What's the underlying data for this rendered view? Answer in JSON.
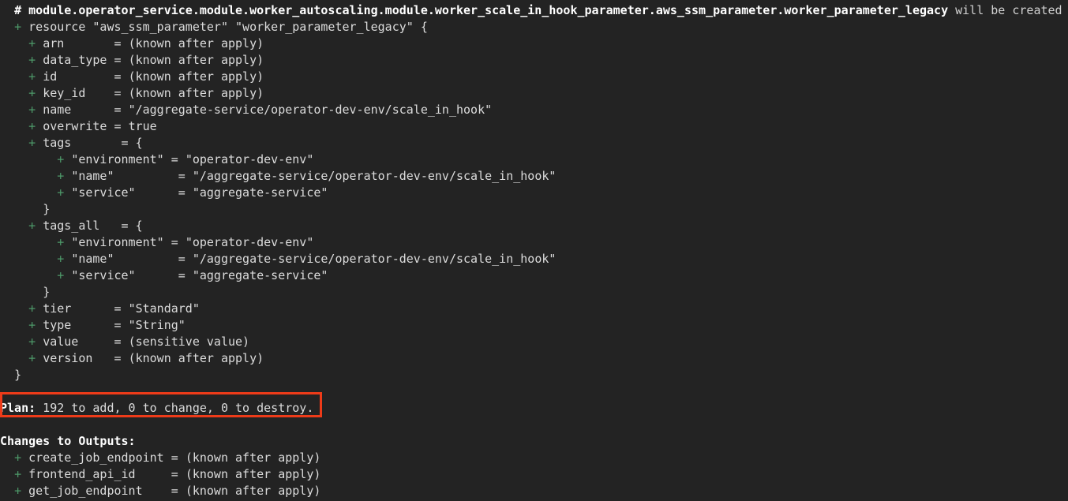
{
  "terminal": {
    "background_color": "#232323",
    "foreground_color": "#dcdcdc",
    "accent_add_color": "#4e9a6a",
    "annotation_color": "#ee3b19",
    "header": {
      "comment_marker": "#",
      "resource_address": "module.operator_service.module.worker_autoscaling.module.worker_scale_in_hook_parameter.aws_ssm_parameter.worker_parameter_legacy",
      "action_text": "will be created"
    },
    "resource": {
      "marker": "+",
      "keyword": "resource",
      "type": "\"aws_ssm_parameter\"",
      "name": "\"worker_parameter_legacy\"",
      "open_brace": "{",
      "close_brace": "}"
    },
    "attributes": [
      {
        "marker": "+",
        "name": "arn",
        "pad": "      ",
        "eq": "=",
        "value": "(known after apply)"
      },
      {
        "marker": "+",
        "name": "data_type",
        "pad": "",
        "eq": "=",
        "value": "(known after apply)"
      },
      {
        "marker": "+",
        "name": "id",
        "pad": "       ",
        "eq": "=",
        "value": "(known after apply)"
      },
      {
        "marker": "+",
        "name": "key_id",
        "pad": "   ",
        "eq": "=",
        "value": "(known after apply)"
      },
      {
        "marker": "+",
        "name": "name",
        "pad": "     ",
        "eq": "=",
        "value": "\"/aggregate-service/operator-dev-env/scale_in_hook\""
      },
      {
        "marker": "+",
        "name": "overwrite",
        "pad": "",
        "eq": "=",
        "value": "true"
      }
    ],
    "tags_block": {
      "marker": "+",
      "label": "tags",
      "label_pad": "      ",
      "eq": "=",
      "open_brace": "{",
      "close_brace": "}",
      "entries": [
        {
          "marker": "+",
          "key": "\"environment\"",
          "pad": "",
          "eq": "=",
          "value": "\"operator-dev-env\""
        },
        {
          "marker": "+",
          "key": "\"name\"",
          "pad": "        ",
          "eq": "=",
          "value": "\"/aggregate-service/operator-dev-env/scale_in_hook\""
        },
        {
          "marker": "+",
          "key": "\"service\"",
          "pad": "     ",
          "eq": "=",
          "value": "\"aggregate-service\""
        }
      ]
    },
    "tags_all_block": {
      "marker": "+",
      "label": "tags_all",
      "label_pad": "  ",
      "eq": "=",
      "open_brace": "{",
      "close_brace": "}",
      "entries": [
        {
          "marker": "+",
          "key": "\"environment\"",
          "pad": "",
          "eq": "=",
          "value": "\"operator-dev-env\""
        },
        {
          "marker": "+",
          "key": "\"name\"",
          "pad": "        ",
          "eq": "=",
          "value": "\"/aggregate-service/operator-dev-env/scale_in_hook\""
        },
        {
          "marker": "+",
          "key": "\"service\"",
          "pad": "     ",
          "eq": "=",
          "value": "\"aggregate-service\""
        }
      ]
    },
    "attributes_tail": [
      {
        "marker": "+",
        "name": "tier",
        "pad": "     ",
        "eq": "=",
        "value": "\"Standard\""
      },
      {
        "marker": "+",
        "name": "type",
        "pad": "     ",
        "eq": "=",
        "value": "\"String\""
      },
      {
        "marker": "+",
        "name": "value",
        "pad": "    ",
        "eq": "=",
        "value": "(sensitive value)"
      },
      {
        "marker": "+",
        "name": "version",
        "pad": "  ",
        "eq": "=",
        "value": "(known after apply)"
      }
    ],
    "plan_summary": {
      "label": "Plan:",
      "detail": " 192 to add, 0 to change, 0 to destroy.",
      "add_count": "192",
      "change_count": "0",
      "destroy_count": "0",
      "highlighted": true
    },
    "outputs": {
      "heading": "Changes to Outputs:",
      "items": [
        {
          "marker": "+",
          "name": "create_job_endpoint",
          "pad": "",
          "eq": "=",
          "value": "(known after apply)"
        },
        {
          "marker": "+",
          "name": "frontend_api_id",
          "pad": "    ",
          "eq": "=",
          "value": "(known after apply)"
        },
        {
          "marker": "+",
          "name": "get_job_endpoint",
          "pad": "   ",
          "eq": "=",
          "value": "(known after apply)"
        }
      ]
    }
  }
}
